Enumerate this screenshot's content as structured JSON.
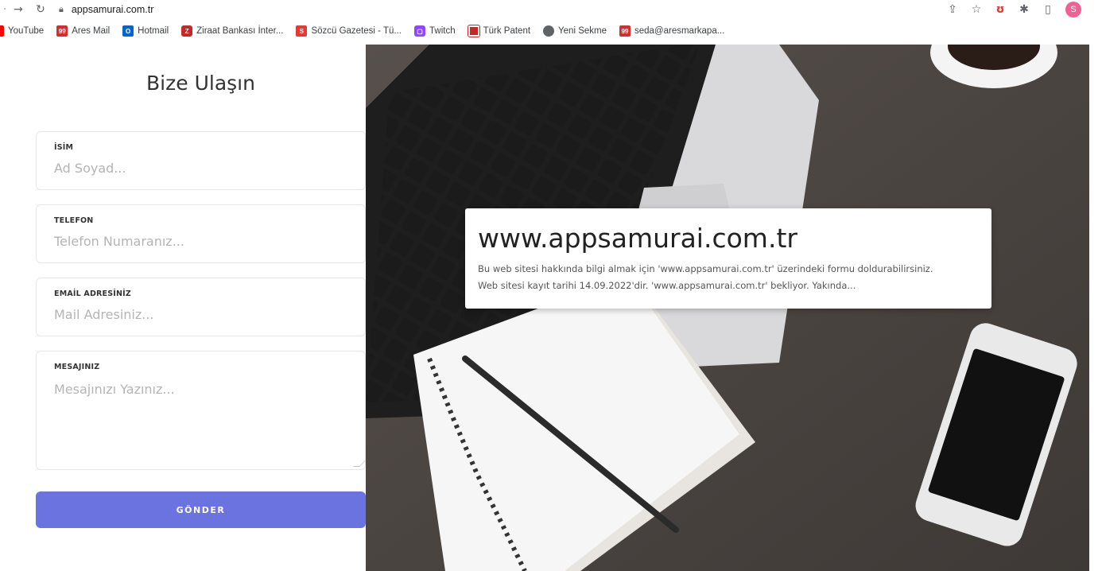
{
  "browser": {
    "url": "appsamurai.com.tr",
    "profile_initial": "S"
  },
  "bookmarks": [
    {
      "label": "YouTube"
    },
    {
      "label": "Ares Mail"
    },
    {
      "label": "Hotmail"
    },
    {
      "label": "Ziraat Bankası İnter..."
    },
    {
      "label": "Sözcü Gazetesi - Tü..."
    },
    {
      "label": "Twitch"
    },
    {
      "label": "Türk Patent"
    },
    {
      "label": "Yeni Sekme"
    },
    {
      "label": "seda@aresmarkapa..."
    }
  ],
  "form": {
    "title": "Bize Ulaşın",
    "name_label": "İSİM",
    "name_placeholder": "Ad Soyad...",
    "phone_label": "TELEFON",
    "phone_placeholder": "Telefon Numaranız...",
    "email_label": "EMAİL ADRESİNİZ",
    "email_placeholder": "Mail Adresiniz...",
    "message_label": "MESAJINIZ",
    "message_placeholder": "Mesajınızı Yazınız...",
    "submit_label": "GÖNDER",
    "accent_color": "#6b73e0"
  },
  "hero": {
    "title": "www.appsamurai.com.tr",
    "line1": "Bu web sitesi hakkında bilgi almak için 'www.appsamurai.com.tr' üzerindeki formu doldurabilirsiniz.",
    "line2": "Web sitesi kayıt tarihi 14.09.2022'dir. 'www.appsamurai.com.tr' bekliyor. Yakında..."
  }
}
